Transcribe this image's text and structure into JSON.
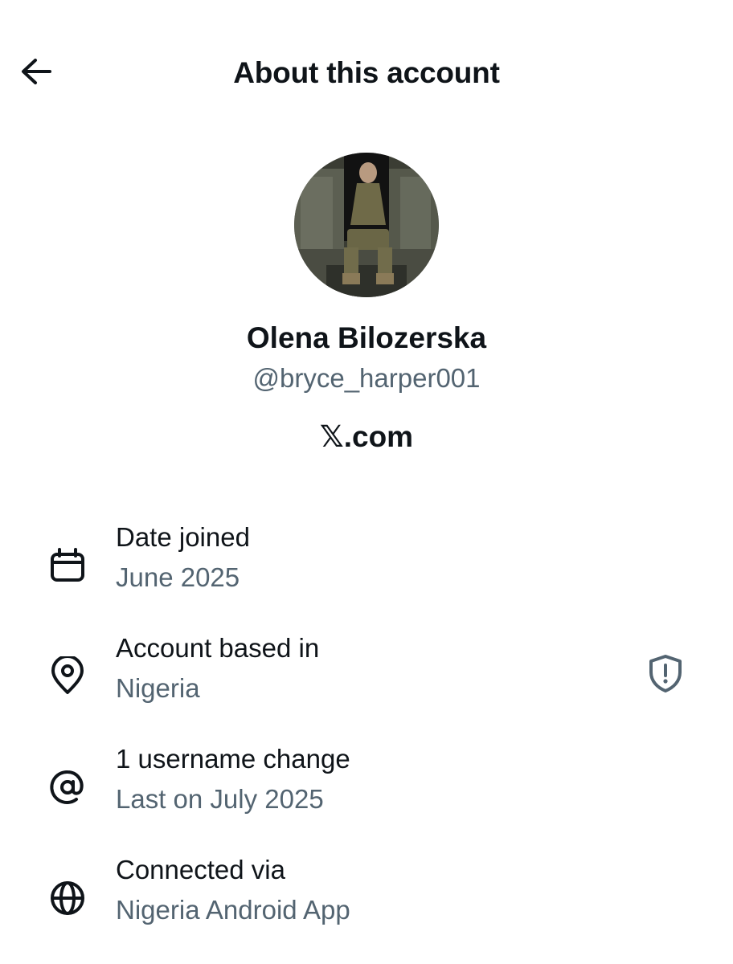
{
  "header": {
    "title": "About this account",
    "back_icon": "arrow-left-icon"
  },
  "profile": {
    "display_name": "Olena Bilozerska",
    "handle": "@bryce_harper001",
    "site": "𝕏.com"
  },
  "info": [
    {
      "icon": "calendar-icon",
      "title": "Date joined",
      "value": "June 2025"
    },
    {
      "icon": "location-pin-icon",
      "title": "Account based in",
      "value": "Nigeria",
      "badge_icon": "shield-alert-icon"
    },
    {
      "icon": "at-sign-icon",
      "title": "1 username change",
      "value": "Last on July 2025"
    },
    {
      "icon": "globe-icon",
      "title": "Connected via",
      "value": "Nigeria Android App"
    }
  ],
  "colors": {
    "primary_text": "#0f1419",
    "secondary_text": "#536471",
    "background": "#ffffff"
  }
}
